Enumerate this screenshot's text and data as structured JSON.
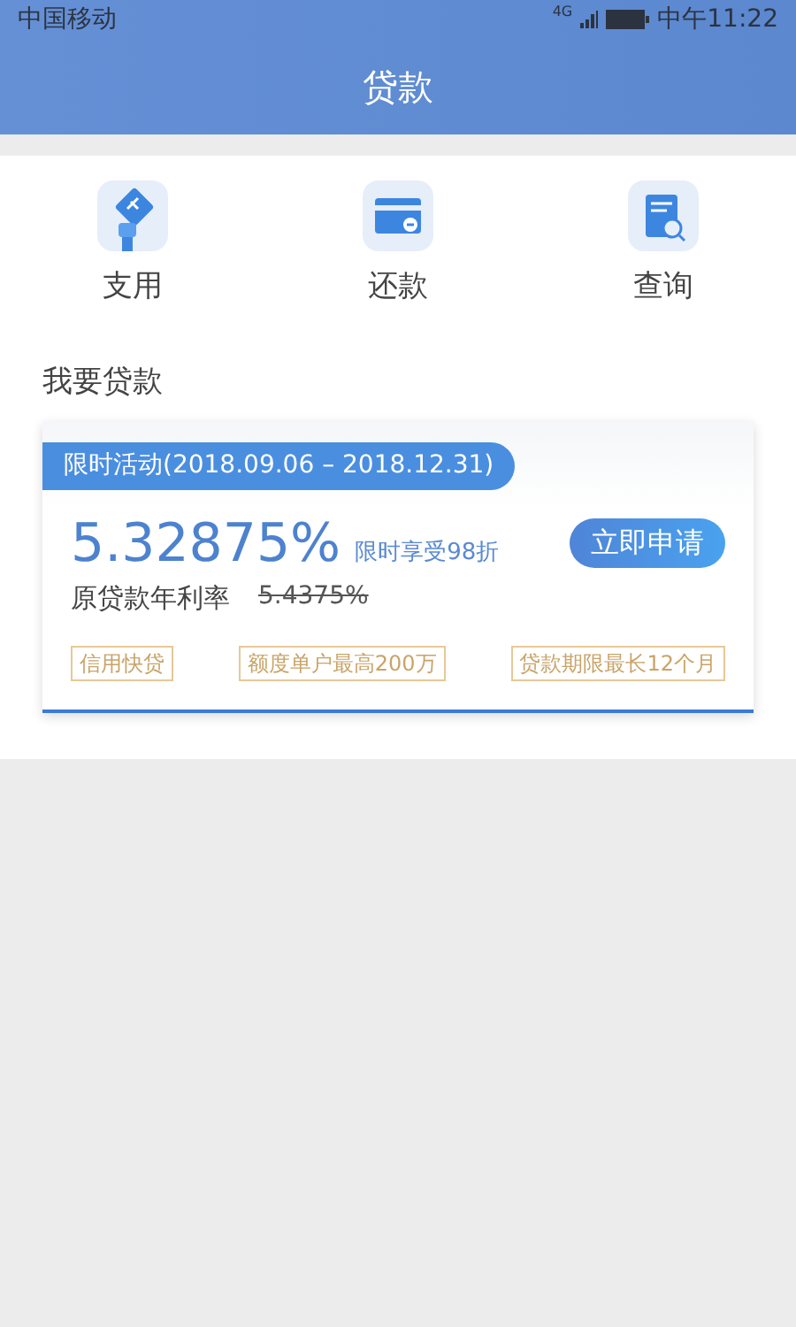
{
  "status_bar": {
    "carrier": "中国移动",
    "network": "4G",
    "time": "中午11:22"
  },
  "header": {
    "title": "贷款"
  },
  "quick_menu": [
    {
      "label": "支用",
      "kind": "hand"
    },
    {
      "label": "还款",
      "kind": "card"
    },
    {
      "label": "查询",
      "kind": "doc"
    }
  ],
  "section_title": "我要贷款",
  "offer": {
    "promo": "限时活动(2018.09.06 – 2018.12.31)",
    "rate": "5.32875%",
    "discount": "限时享受98折",
    "apply_button": "立即申请",
    "original_label": "原贷款年利率",
    "original_rate": "5.4375%",
    "tags": [
      "信用快贷",
      "额度单户最高200万",
      "贷款期限最长12个月"
    ]
  }
}
